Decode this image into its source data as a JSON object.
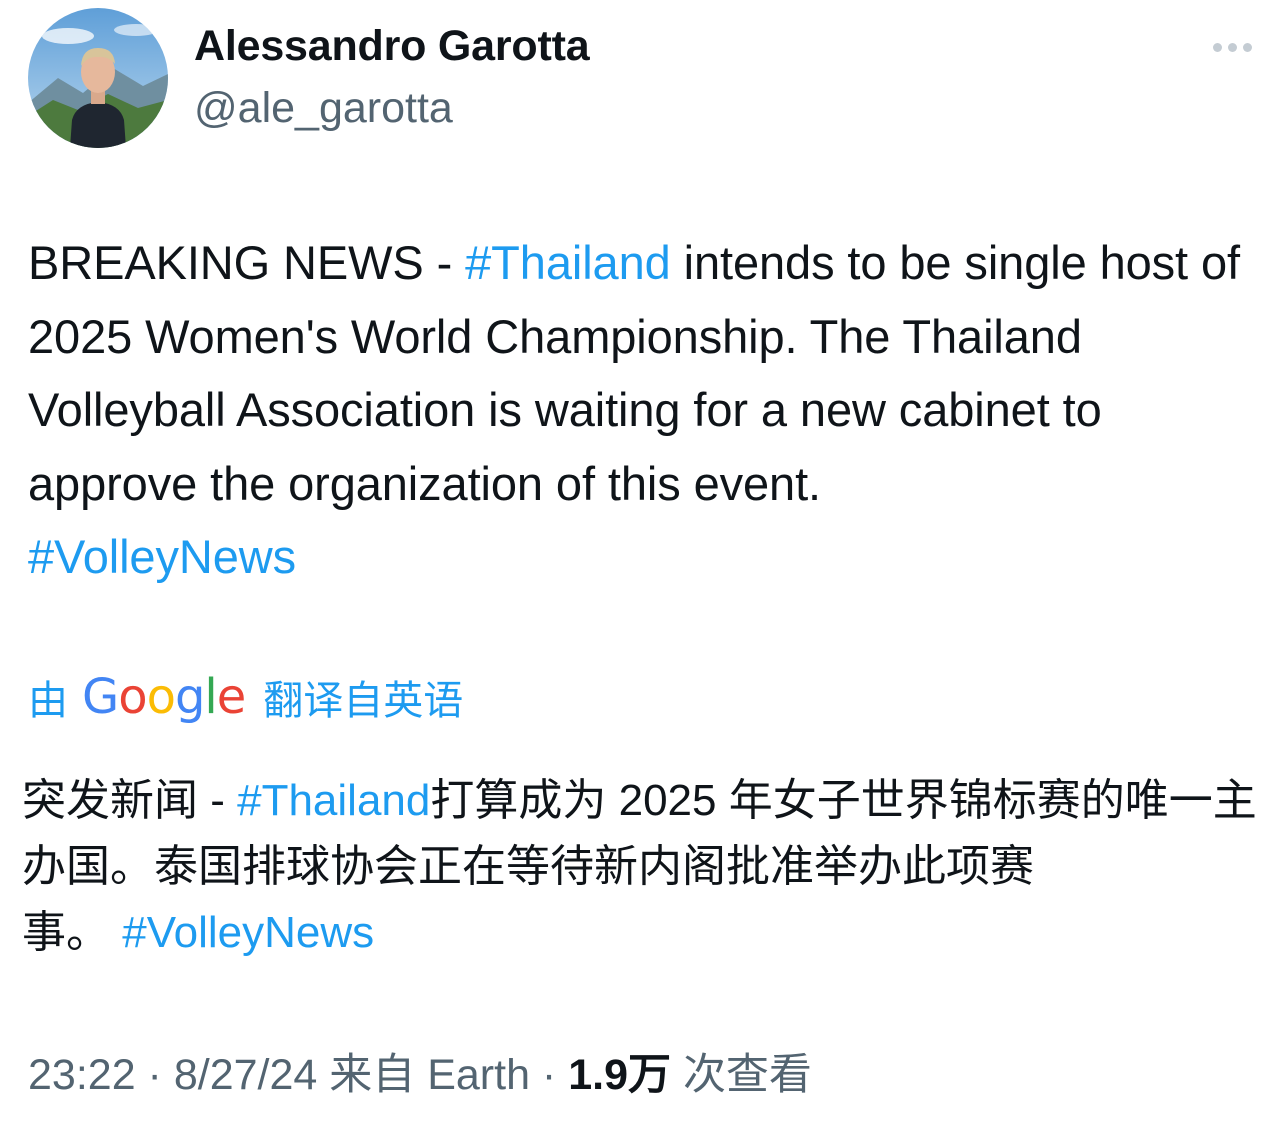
{
  "author": {
    "display_name": "Alessandro Garotta",
    "handle": "@ale_garotta",
    "avatar_icon": "profile-photo"
  },
  "more_icon": "more-dots-icon",
  "tweet": {
    "text_1": "BREAKING NEWS - ",
    "hashtag_1": "#Thailand",
    "text_2": " intends to be single host of 2025 Women's World Championship. The Thailand Volleyball Association is waiting for a new cabinet to approve the organization of this event.",
    "hashtag_2": "#VolleyNews"
  },
  "translation": {
    "prefix": "由",
    "provider": "Google",
    "suffix": "翻译自英语",
    "text_1": "突发新闻 - ",
    "hashtag_1": "#Thailand",
    "text_2": "打算成为 2025 年女子世界锦标赛的唯一主办国。泰国排球协会正在等待新内阁批准举办此项赛事。",
    "hashtag_2": "#VolleyNews"
  },
  "meta": {
    "time": "23:22",
    "separator_1": " · ",
    "date": "8/27/24",
    "source_prefix": "来自",
    "source": "Earth",
    "separator_2": " · ",
    "views_count": "1.9万",
    "views_label": "次查看"
  },
  "colors": {
    "link": "#1d9bf0",
    "text": "#0f1419",
    "secondary": "#536471"
  }
}
